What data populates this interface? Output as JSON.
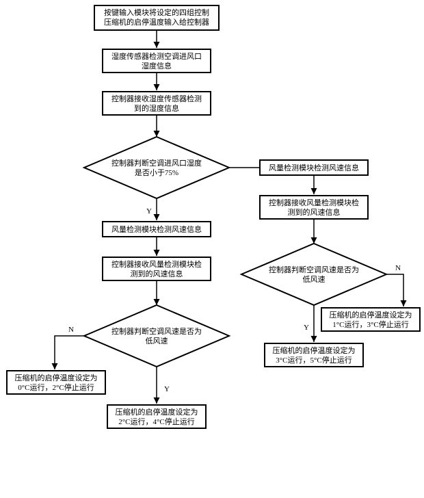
{
  "nodes": {
    "n1": [
      "按键输入模块将设定的四组控制",
      "压缩机的启停温度输入给控制器"
    ],
    "n2": [
      "湿度传感器检测空调进风口",
      "湿度信息"
    ],
    "n3": [
      "控制器接收湿度传感器检测",
      "到的湿度信息"
    ],
    "d1": [
      "控制器判断空调进风口湿度",
      "是否小于75%"
    ],
    "n4": [
      "风量检测模块检测风速信息"
    ],
    "n5": [
      "控制器接收风量检测模块检",
      "测到的风速信息"
    ],
    "d2": [
      "控制器判断空调风速是否为",
      "低风速"
    ],
    "n6": [
      "压缩机的启停温度设定为",
      "0°C运行，2°C停止运行"
    ],
    "n7": [
      "压缩机的启停温度设定为",
      "2°C运行，4°C停止运行"
    ],
    "n8": [
      "风量检测模块检测风速信息"
    ],
    "n9": [
      "控制器接收风量检测模块检",
      "测到的风速信息"
    ],
    "d3": [
      "控制器判断空调风速是否为",
      "低风速"
    ],
    "n10": [
      "压缩机的启停温度设定为",
      "3°C运行，5°C停止运行"
    ],
    "n11": [
      "压缩机的启停温度设定为",
      "1°C运行，3°C停止运行"
    ]
  },
  "labels": {
    "yes": "Y",
    "no": "N"
  }
}
